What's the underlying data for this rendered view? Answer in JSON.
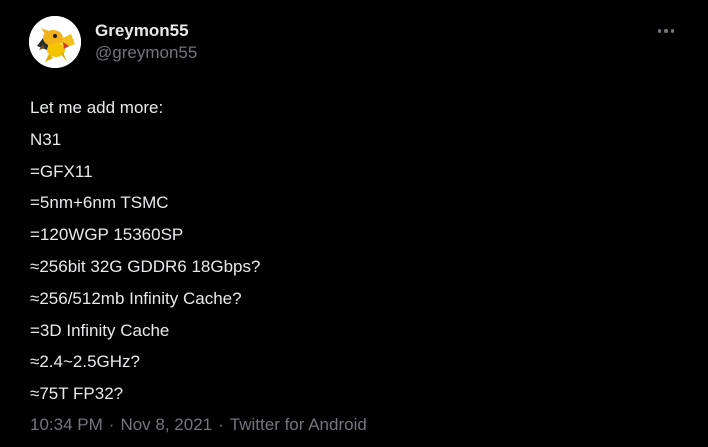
{
  "tweet": {
    "author": {
      "display_name": "Greymon55",
      "handle": "@greymon55",
      "avatar_icon": "cartoon-creature-avatar-icon"
    },
    "more_icon": "more-horizontal-icon",
    "lines": [
      "Let me add more:",
      "N31",
      "=GFX11",
      "=5nm+6nm TSMC",
      "=120WGP 15360SP",
      "≈256bit 32G GDDR6 18Gbps?",
      "≈256/512mb Infinity Cache?",
      "=3D Infinity Cache",
      "≈2.4~2.5GHz?",
      "≈75T FP32?"
    ],
    "meta": {
      "time": "10:34 PM",
      "separator": "·",
      "date": "Nov 8, 2021",
      "source": "Twitter for Android"
    }
  },
  "colors": {
    "background": "#000000",
    "primary_text": "#e7e9ea",
    "secondary_text": "#71767b"
  }
}
